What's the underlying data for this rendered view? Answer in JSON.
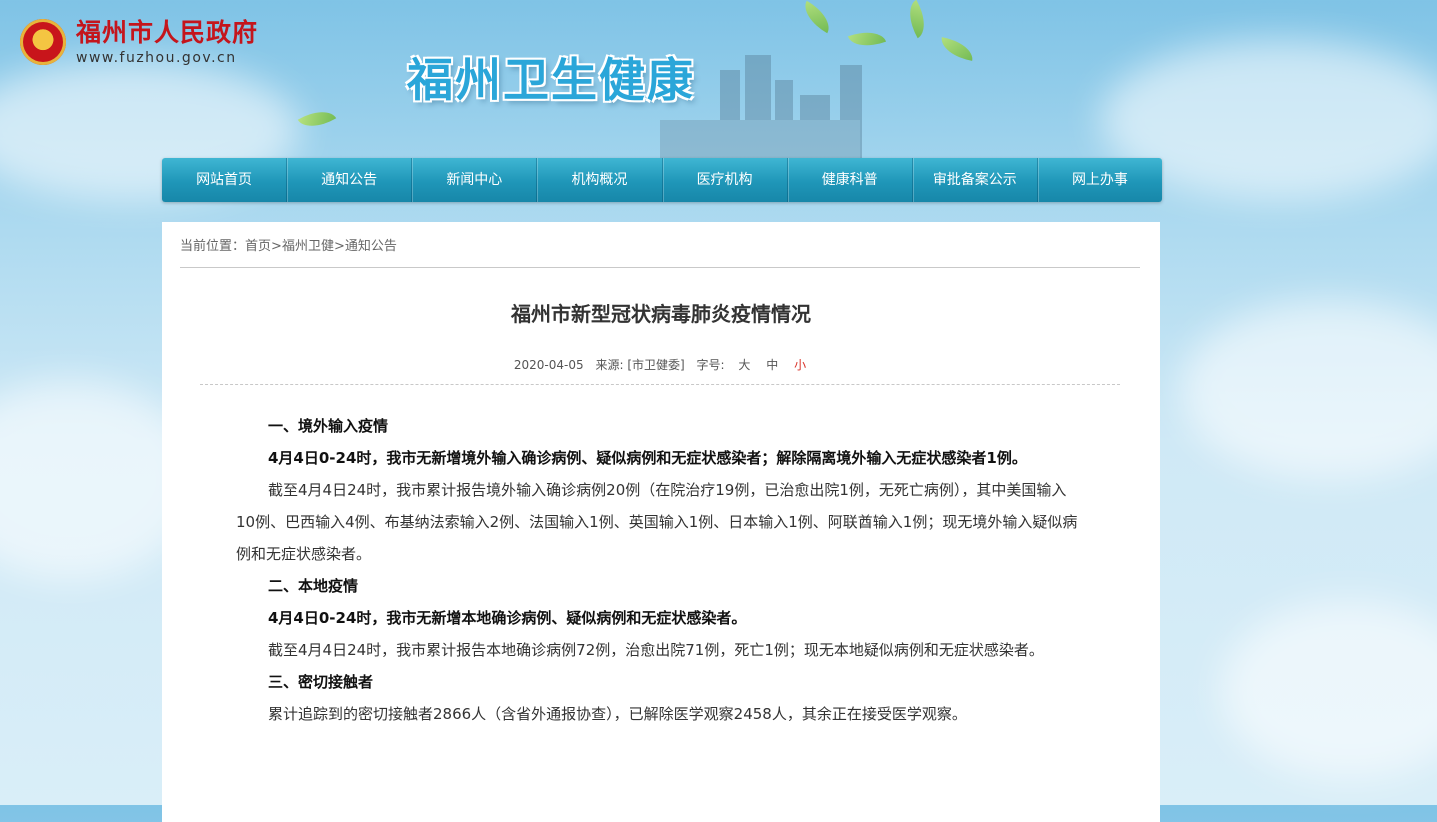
{
  "gov": {
    "name": "福州市人民政府",
    "url": "www.fuzhou.gov.cn"
  },
  "site_title": "福州卫生健康",
  "nav": [
    "网站首页",
    "通知公告",
    "新闻中心",
    "机构概况",
    "医疗机构",
    "健康科普",
    "审批备案公示",
    "网上办事"
  ],
  "breadcrumb": {
    "prefix": "当前位置：",
    "items": [
      "首页",
      "福州卫健",
      "通知公告"
    ],
    "sep": ">"
  },
  "article": {
    "title": "福州市新型冠状病毒肺炎疫情情况",
    "date": "2020-04-05",
    "source": "来源: [市卫健委]",
    "font_size_label": "字号:",
    "font_sizes": [
      "大",
      "中",
      "小"
    ],
    "paragraphs": [
      {
        "bold": true,
        "text": "一、境外输入疫情"
      },
      {
        "bold": true,
        "text": "4月4日0-24时，我市无新增境外输入确诊病例、疑似病例和无症状感染者；解除隔离境外输入无症状感染者1例。"
      },
      {
        "bold": false,
        "text": "截至4月4日24时，我市累计报告境外输入确诊病例20例（在院治疗19例，已治愈出院1例，无死亡病例），其中美国输入10例、巴西输入4例、布基纳法索输入2例、法国输入1例、英国输入1例、日本输入1例、阿联酋输入1例；现无境外输入疑似病例和无症状感染者。"
      },
      {
        "bold": true,
        "text": "二、本地疫情"
      },
      {
        "bold": true,
        "text": "4月4日0-24时，我市无新增本地确诊病例、疑似病例和无症状感染者。"
      },
      {
        "bold": false,
        "text": "截至4月4日24时，我市累计报告本地确诊病例72例，治愈出院71例，死亡1例；现无本地疑似病例和无症状感染者。"
      },
      {
        "bold": true,
        "text": "三、密切接触者"
      },
      {
        "bold": false,
        "text": "累计追踪到的密切接触者2866人（含省外通报协查），已解除医学观察2458人，其余正在接受医学观察。"
      }
    ]
  },
  "colors": {
    "nav": "#1f96b8",
    "gov_red": "#c4151c",
    "title_blue": "#2aa6d9",
    "active_fs": "#d9342b"
  }
}
